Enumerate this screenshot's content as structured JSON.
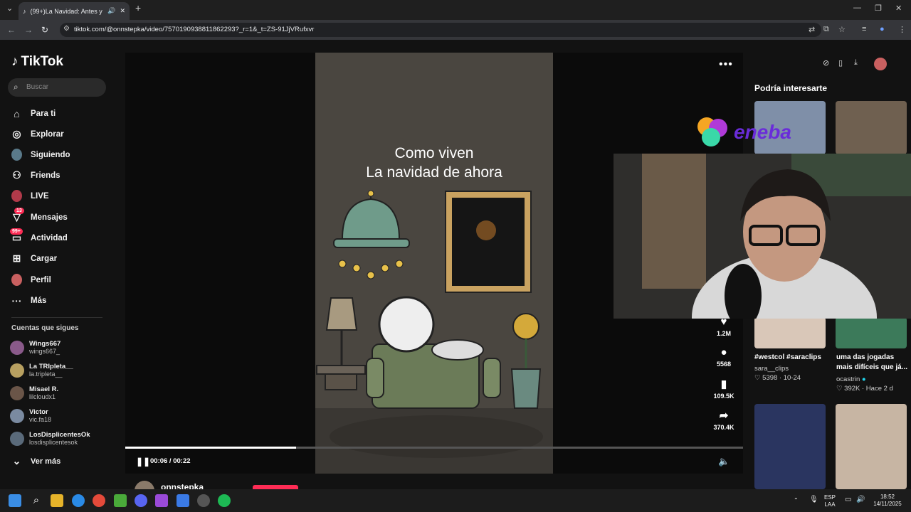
{
  "browser": {
    "tab_title": "(99+)La Navidad: Antes y A",
    "url": "tiktok.com/@onnstepka/video/7570190938811862293?_r=1&_t=ZS-91JjVRufxvr"
  },
  "sidebar": {
    "logo": "TikTok",
    "search_placeholder": "Buscar",
    "items": [
      {
        "label": "Para ti"
      },
      {
        "label": "Explorar"
      },
      {
        "label": "Siguiendo"
      },
      {
        "label": "Friends"
      },
      {
        "label": "LIVE"
      },
      {
        "label": "Mensajes",
        "badge": "13"
      },
      {
        "label": "Actividad",
        "badge": "99+"
      },
      {
        "label": "Cargar"
      },
      {
        "label": "Perfil"
      },
      {
        "label": "Más"
      }
    ],
    "following_title": "Cuentas que sigues",
    "accounts": [
      {
        "name": "Wings667",
        "handle": "wings667_"
      },
      {
        "name": "La TRIpleta__",
        "handle": "la.tripleta__"
      },
      {
        "name": "Misael R.",
        "handle": "lilcloudx1"
      },
      {
        "name": "Victor",
        "handle": "vic.fa18"
      },
      {
        "name": "LosDisplicentesOk",
        "handle": "losdisplicentesok"
      }
    ],
    "see_more": "Ver más"
  },
  "video": {
    "caption_line1": "Como viven",
    "caption_line2": "La navidad de ahora",
    "likes": "1.2M",
    "comments": "5568",
    "saves": "109.5K",
    "shares": "370.4K",
    "time": "00:06 / 00:22",
    "progress": 0.276,
    "author": "onnstepka"
  },
  "recommended": {
    "title": "Podría interesarte",
    "cards": [
      {
        "caption": "#westcol #saraclips",
        "user": "sara__clips",
        "likes": "5398",
        "date": "10-24"
      },
      {
        "caption": "uma das jogadas mais difíceis que já...",
        "user": "ocastrin",
        "likes": "392K",
        "date": "Hace 2 d"
      }
    ]
  },
  "overlay": {
    "brand": "eneba"
  },
  "taskbar": {
    "lang1": "ESP",
    "lang2": "LAA",
    "time": "18:52",
    "date": "14/11/2025"
  },
  "colors": {
    "accent": "#fe2c55",
    "background": "#121212"
  }
}
